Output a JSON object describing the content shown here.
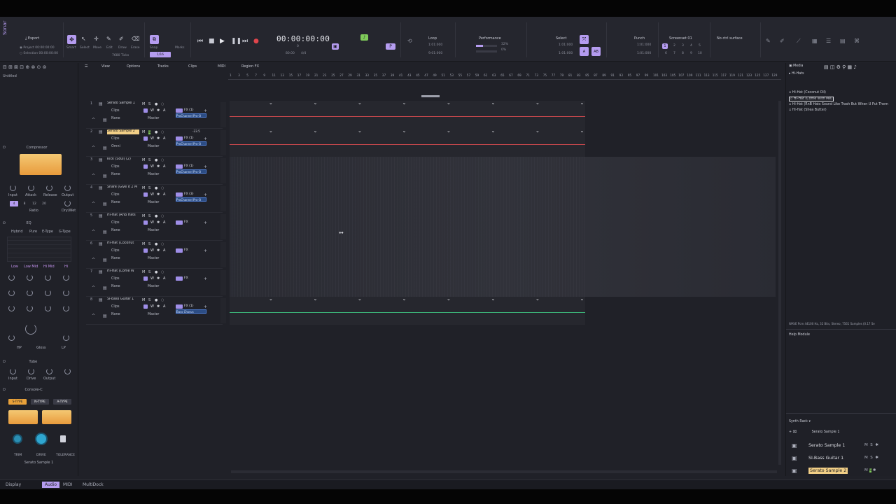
{
  "control_bar": {
    "app_label": "Sonar",
    "export_label": "Export",
    "project_label": "Project",
    "project_time": "00:00:00:00",
    "selection_label": "Selection",
    "selection_time": "00:00:00:00",
    "tools": [
      "Smart",
      "Select",
      "Move",
      "Edit",
      "Draw",
      "Erase"
    ],
    "snap_label": "Snap",
    "snap_value": "1/16",
    "marks_label": "Marks",
    "ticks_label": "7680 Ticks",
    "time_display": "00:00:00:00",
    "time_sub": "0",
    "tempo": "80.00",
    "meter": "4/4",
    "loop_label": "Loop",
    "loop_start": "1:01:000",
    "loop_end": "9:01:000",
    "performance_label": "Performance",
    "performance_pct": "32%",
    "performance_pct2": "0%",
    "select_label": "Select",
    "select_start": "1:01:000",
    "select_end": "1:01:000",
    "punch_label": "Punch",
    "punch_start": "1:01:000",
    "punch_end": "1:01:000",
    "screenset_label": "Screenset 01",
    "screenset_nums": [
      "1",
      "2",
      "3",
      "4",
      "5",
      "6",
      "7",
      "8",
      "9",
      "10"
    ],
    "control_surface": "No ctrl surface"
  },
  "inspector": {
    "track_name": "Untitled",
    "compressor_title": "Compressor",
    "compressor_knobs": [
      "Input",
      "Attack",
      "Release",
      "Output"
    ],
    "ratio_label": "Ratio",
    "ratio_values": [
      "4",
      "8",
      "12",
      "20"
    ],
    "drywet_label": "Dry/Wet",
    "eq_title": "EQ",
    "eq_types": [
      "Hybrid",
      "Pure",
      "E-Type",
      "G-Type"
    ],
    "eq_bands": [
      "Low",
      "Low Mid",
      "Hi Mid",
      "Hi"
    ],
    "eq_bottom": [
      "HP",
      "Gloss",
      "LP"
    ],
    "tube_title": "Tube",
    "tube_knobs": [
      "Input",
      "Drive",
      "Output"
    ],
    "console_title": "Console-C",
    "console_modes": [
      "S-TYPE",
      "N-TYPE",
      "A-TYPE"
    ],
    "console_knobs": [
      "TRIM",
      "DRIVE",
      "TOLERANCE"
    ],
    "console_track": "Serato Sample 1"
  },
  "track_menu": [
    "View",
    "Options",
    "Tracks",
    "Clips",
    "MIDI",
    "Region FX"
  ],
  "ruler_numbers": [
    "1",
    "3",
    "5",
    "7",
    "9",
    "11",
    "13",
    "15",
    "17",
    "19",
    "21",
    "23",
    "25",
    "27",
    "29",
    "31",
    "33",
    "35",
    "37",
    "39",
    "41",
    "43",
    "45",
    "47",
    "49",
    "51",
    "53",
    "55",
    "57",
    "59",
    "61",
    "63",
    "65",
    "67",
    "69",
    "71",
    "73",
    "75",
    "77",
    "79",
    "81",
    "83",
    "85",
    "87",
    "89",
    "91",
    "93",
    "95",
    "97",
    "99",
    "101",
    "103",
    "105",
    "107",
    "109",
    "111",
    "113",
    "115",
    "117",
    "119",
    "121",
    "123",
    "125",
    "127",
    "129"
  ],
  "tracks": [
    {
      "num": "1",
      "name": "Serato Sample 1",
      "clips": "Clips",
      "input": "None",
      "output": "Master",
      "fx": "FX (1)",
      "plugin": "ProChannel Pro-Q",
      "selected": false,
      "lane_color": "#c8474c"
    },
    {
      "num": "2",
      "name": "Serato Sample 2",
      "clips": "Clips",
      "input": "Omni",
      "output": "Master",
      "fx": "FX (1)",
      "plugin": "ProChannel Pro-Q",
      "selected": true,
      "lane_color": "#c8474c",
      "vol": "-23.5"
    },
    {
      "num": "3",
      "name": "Kick (Soul) (2)",
      "clips": "Clips",
      "input": "None",
      "output": "Master",
      "fx": "FX (1)",
      "plugin": "ProChannel Pro-Q",
      "selected": false,
      "lane_color": ""
    },
    {
      "num": "4",
      "name": "Snare (Give It 2 M",
      "clips": "Clips",
      "input": "None",
      "output": "Master",
      "fx": "FX (3)",
      "plugin": "ProChannel Pro-Q",
      "selected": false,
      "lane_color": ""
    },
    {
      "num": "5",
      "name": "Hi-Hat (RnB Hats",
      "clips": "Clips",
      "input": "None",
      "output": "Master",
      "fx": "FX",
      "plugin": "",
      "selected": false,
      "lane_color": ""
    },
    {
      "num": "6",
      "name": "Hi-Hat (Coconut",
      "clips": "Clips",
      "input": "None",
      "output": "Master",
      "fx": "FX",
      "plugin": "",
      "selected": false,
      "lane_color": ""
    },
    {
      "num": "7",
      "name": "Hi-Hat (Come W",
      "clips": "Clips",
      "input": "None",
      "output": "Master",
      "fx": "FX",
      "plugin": "",
      "selected": false,
      "lane_color": ""
    },
    {
      "num": "8",
      "name": "SI-Bass Guitar 1",
      "clips": "Clips",
      "input": "None",
      "output": "Master",
      "fx": "FX (1)",
      "plugin": "Bass Chorus",
      "selected": false,
      "lane_color": "#3db87a"
    }
  ],
  "track_buttons": [
    "M",
    "S",
    "R",
    "W",
    "A"
  ],
  "browser": {
    "tab_media": "Media",
    "folder": "Hi-Hats",
    "items": [
      "Hi-Hat (Coconut Oil)",
      "Hi-Hat (Come With Me)",
      "Hi-Hat (RnB Hats Sound Like Trash But When U Put Them",
      "Hi-Hat (Shea Butter)"
    ],
    "file_info": "WAVE Pcm 44100 Hz, 32 Bits, Stereo, 7561 Samples (0.17 Se",
    "help_title": "Help Module",
    "synth_rack_title": "Synth Rack",
    "synth_selected": "Serato Sample 1",
    "synths": [
      {
        "name": "Serato Sample 1",
        "selected": false
      },
      {
        "name": "SI-Bass Guitar 1",
        "selected": false
      },
      {
        "name": "Serato Sample 2",
        "selected": true
      }
    ]
  },
  "status_bar": {
    "display_label": "Display",
    "audio_label": "Audio",
    "midi_label": "MIDI",
    "multidock_label": "MultiDock"
  },
  "colors": {
    "accent": "#b59cf0",
    "selected_track": "#f1ce86",
    "audio_lane_red": "#c8474c",
    "bass_lane_green": "#3db87a"
  }
}
